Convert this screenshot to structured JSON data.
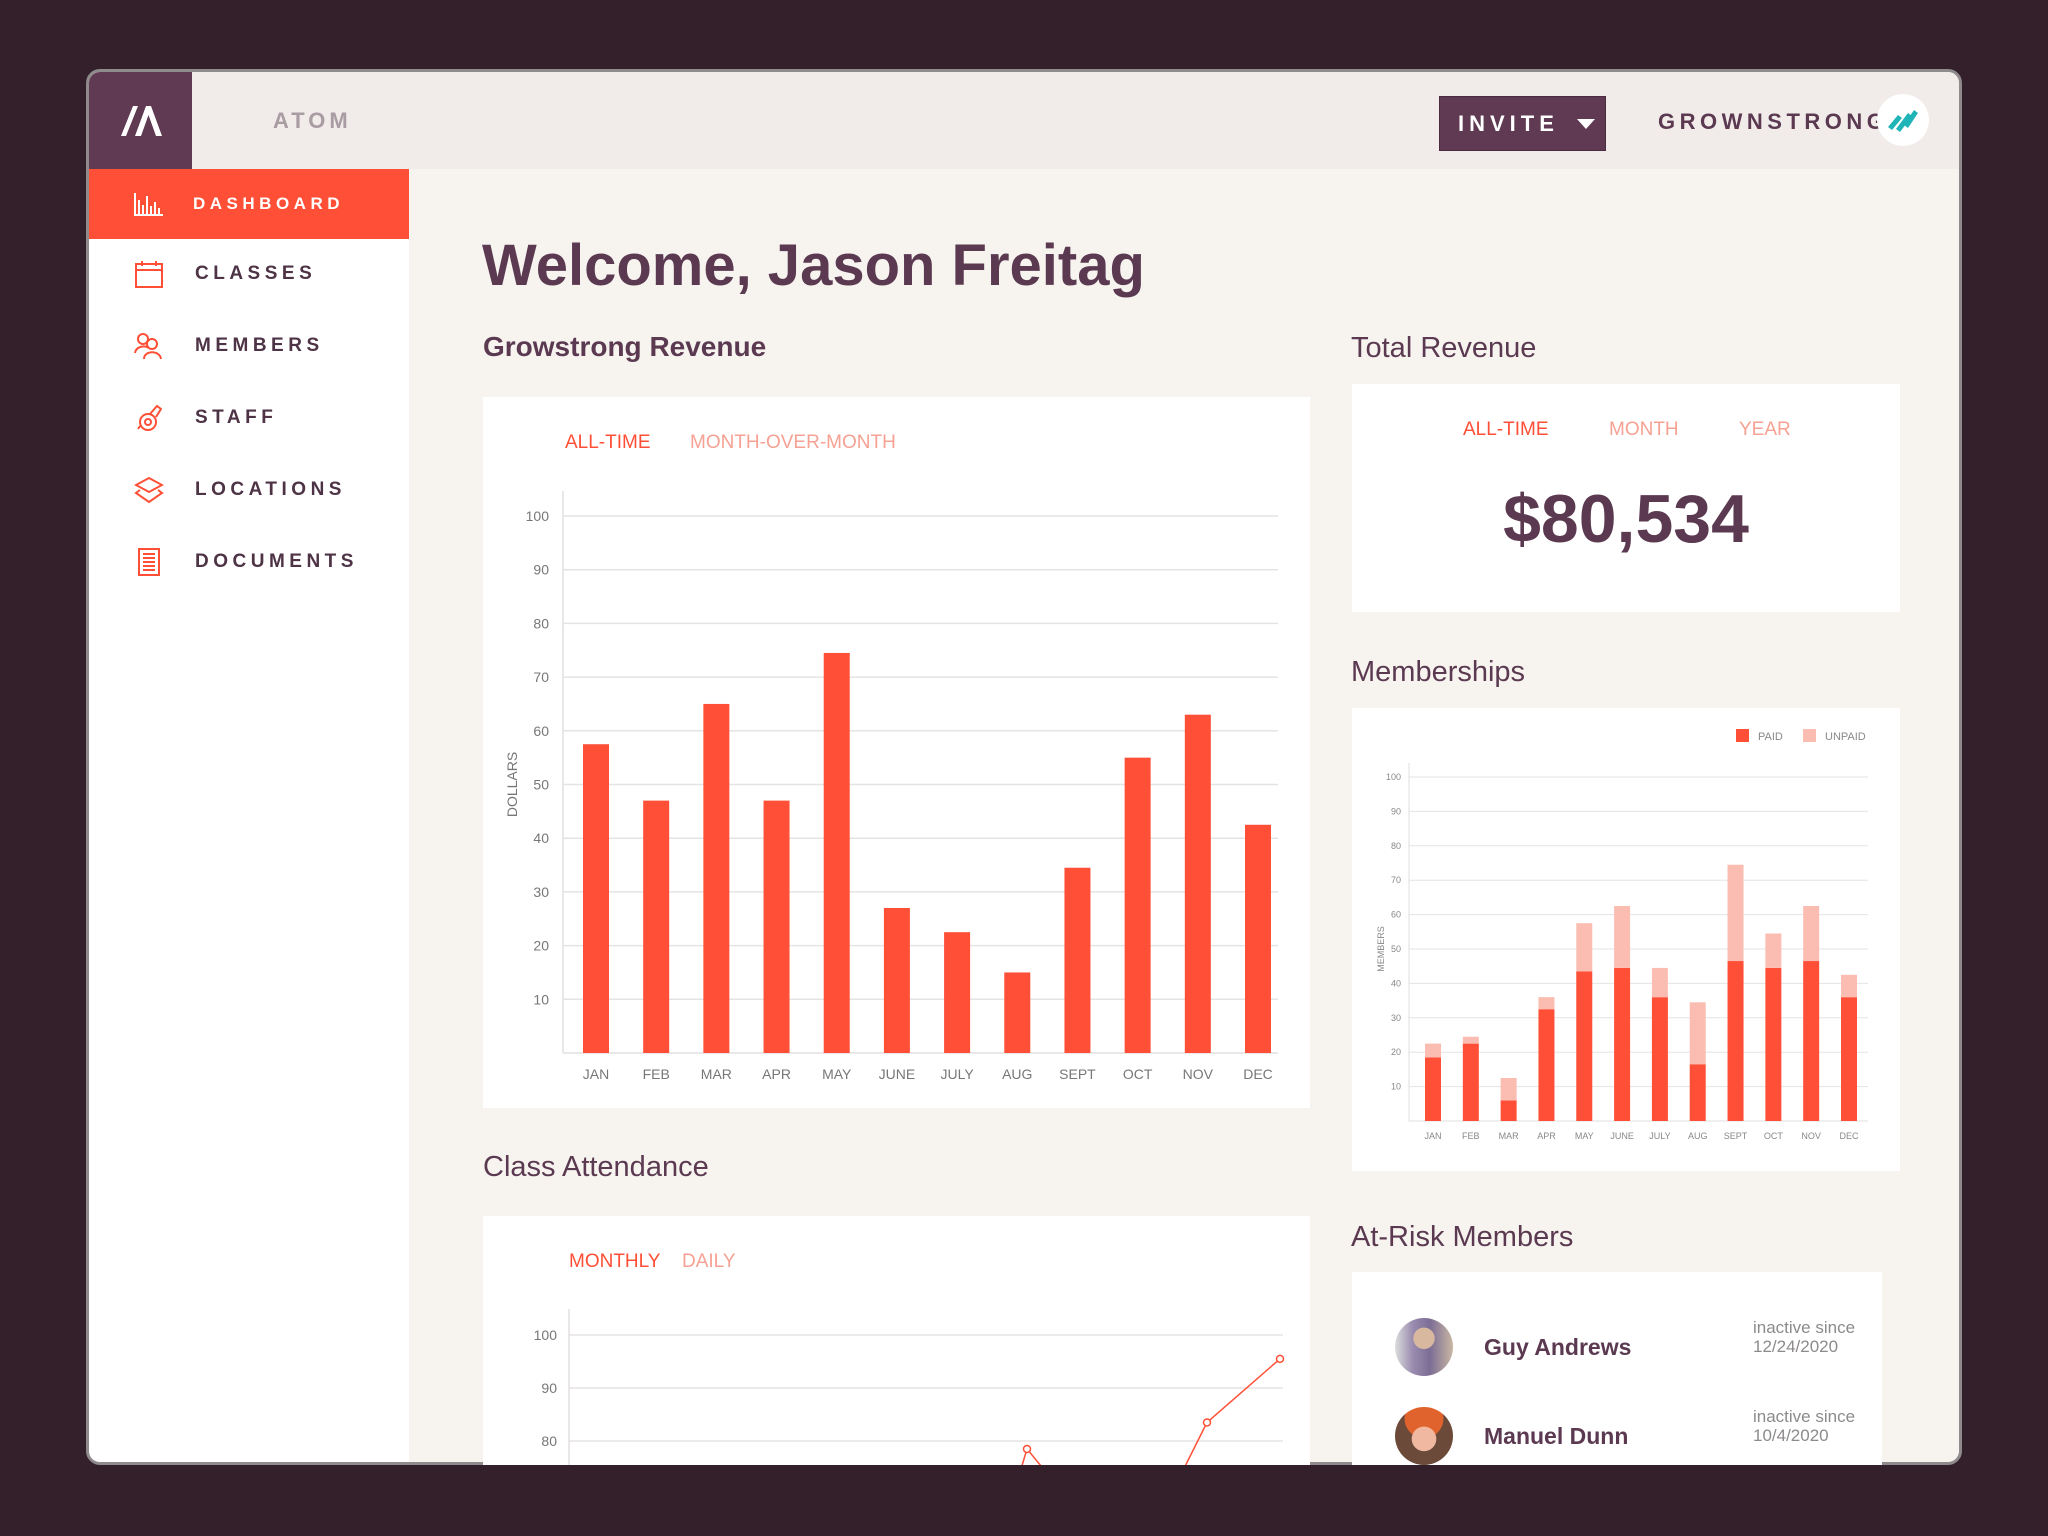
{
  "header": {
    "app_name": "ATOM",
    "invite_label": "INVITE",
    "org_name": "GROWNSTRONG"
  },
  "sidebar": {
    "items": [
      {
        "label": "DASHBOARD",
        "icon": "bar-chart-icon",
        "active": true
      },
      {
        "label": "CLASSES",
        "icon": "calendar-icon"
      },
      {
        "label": "MEMBERS",
        "icon": "users-icon"
      },
      {
        "label": "STAFF",
        "icon": "whistle-icon"
      },
      {
        "label": "LOCATIONS",
        "icon": "layers-icon"
      },
      {
        "label": "DOCUMENTS",
        "icon": "document-icon"
      }
    ]
  },
  "main": {
    "welcome": "Welcome, Jason Freitag",
    "revenue": {
      "title": "Growstrong Revenue",
      "tabs": [
        "ALL-TIME",
        "MONTH-OVER-MONTH"
      ],
      "active_tab": 0
    },
    "attendance": {
      "title": "Class Attendance",
      "tabs": [
        "MONTHLY",
        "DAILY"
      ],
      "active_tab": 0
    },
    "total": {
      "title": "Total Revenue",
      "tabs": [
        "ALL-TIME",
        "MONTH",
        "YEAR"
      ],
      "active_tab": 0,
      "value": "$80,534"
    },
    "memberships": {
      "title": "Memberships"
    },
    "at_risk": {
      "title": "At-Risk Members",
      "members": [
        {
          "name": "Guy Andrews",
          "status": "inactive since",
          "date": "12/24/2020"
        },
        {
          "name": "Manuel Dunn",
          "status": "inactive since",
          "date": "10/4/2020"
        }
      ]
    }
  },
  "colors": {
    "accent": "#ff4f36",
    "accent_light": "#fbbdb2",
    "brand": "#5f3a52",
    "org_logo": "#1fb5b8"
  },
  "chart_data": [
    {
      "type": "bar",
      "ylabel": "DOLLARS",
      "ylim": [
        0,
        100
      ],
      "yticks": [
        10,
        20,
        30,
        40,
        50,
        60,
        70,
        80,
        90,
        100
      ],
      "grid": true,
      "categories": [
        "JAN",
        "FEB",
        "MAR",
        "APR",
        "MAY",
        "JUNE",
        "JULY",
        "AUG",
        "SEPT",
        "OCT",
        "NOV",
        "DEC"
      ],
      "values": [
        57.5,
        47,
        65,
        47,
        74.5,
        27,
        22.5,
        15,
        34.5,
        55,
        63,
        42.5
      ]
    },
    {
      "type": "bar",
      "stacked": true,
      "ylabel": "MEMBERS",
      "ylim": [
        0,
        100
      ],
      "yticks": [
        10,
        20,
        30,
        40,
        50,
        60,
        70,
        80,
        90,
        100
      ],
      "grid": true,
      "legend": "top-right",
      "categories": [
        "JAN",
        "FEB",
        "MAR",
        "APR",
        "MAY",
        "JUNE",
        "JULY",
        "AUG",
        "SEPT",
        "OCT",
        "NOV",
        "DEC"
      ],
      "series": [
        {
          "name": "PAID",
          "values": [
            18.5,
            22.5,
            6,
            32.5,
            43.5,
            44.5,
            36,
            16.5,
            46.5,
            44.5,
            46.5,
            36
          ]
        },
        {
          "name": "UNPAID",
          "values": [
            4,
            2,
            6.5,
            3.5,
            14,
            18,
            8.5,
            18,
            28,
            10,
            16,
            6.5
          ]
        }
      ]
    },
    {
      "type": "line",
      "yticks": [
        80,
        90,
        100
      ],
      "grid": true,
      "visible_points": [
        78.5,
        83.5,
        95.5
      ]
    }
  ]
}
